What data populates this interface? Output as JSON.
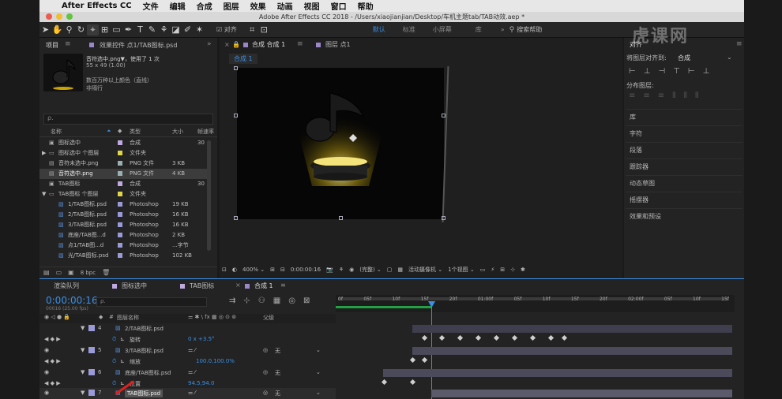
{
  "menubar": {
    "apple": "",
    "app": "After Effects CC",
    "items": [
      "文件",
      "编辑",
      "合成",
      "图层",
      "效果",
      "动画",
      "视图",
      "窗口",
      "帮助"
    ]
  },
  "window": {
    "title": "Adobe After Effects CC 2018 - /Users/xiaojianjian/Desktop/车机主题tab/TAB动效.aep *"
  },
  "toolbar": {
    "align_label": "对齐",
    "workspaces": [
      "默认",
      "标准",
      "小屏幕",
      "库"
    ],
    "search_label": "搜索帮助"
  },
  "project": {
    "tab_label": "项目",
    "effects_tab": "效果控件 点1/TAB图标.psd",
    "preview_name": "音符选中.png▼，使用了 1 次",
    "preview_dims": "55 x 49 (1.00)",
    "preview_colors": "数百万种以上颜色（直线）",
    "preview_interlace": "非隔行",
    "search_placeholder": "ρ.",
    "columns": {
      "name": "名称",
      "type": "类型",
      "size": "大小",
      "fps": "帧速率"
    },
    "rows": [
      {
        "name": "图标选中",
        "type": "合成",
        "size": "",
        "fps": "30"
      },
      {
        "name": "图标选中 个图层",
        "type": "文件夹",
        "size": "",
        "fps": ""
      },
      {
        "name": "音符未选中.png",
        "type": "PNG 文件",
        "size": "3 KB",
        "fps": ""
      },
      {
        "name": "音符选中.png",
        "type": "PNG 文件",
        "size": "4 KB",
        "fps": ""
      },
      {
        "name": "TAB图标",
        "type": "合成",
        "size": "",
        "fps": "30"
      },
      {
        "name": "TAB图标 个图层",
        "type": "文件夹",
        "size": "",
        "fps": ""
      },
      {
        "name": "1/TAB图标.psd",
        "type": "Photoshop",
        "size": "19 KB",
        "fps": ""
      },
      {
        "name": "2/TAB图标.psd",
        "type": "Photoshop",
        "size": "16 KB",
        "fps": ""
      },
      {
        "name": "3/TAB图标.psd",
        "type": "Photoshop",
        "size": "16 KB",
        "fps": ""
      },
      {
        "name": "底座/TAB图...d",
        "type": "Photoshop",
        "size": "2 KB",
        "fps": ""
      },
      {
        "name": "点1/TAB图...d",
        "type": "Photoshop",
        "size": "...字节",
        "fps": ""
      },
      {
        "name": "光/TAB图标.psd",
        "type": "Photoshop",
        "size": "102 KB",
        "fps": ""
      }
    ],
    "bpc": "8 bpc"
  },
  "composition": {
    "tab_label": "合成 合成 1",
    "layer_tab": "图层 点1",
    "breadcrumb": "合成 1",
    "zoom": "400%",
    "timecode": "0:00:00:16",
    "quality": "(完整)",
    "camera": "活动摄像机",
    "views": "1个视图"
  },
  "right_panel": {
    "title": "对齐",
    "align_to_label": "将图层对齐到:",
    "align_to_value": "合成",
    "distribute_label": "分布图层:",
    "items": [
      "库",
      "字符",
      "段落",
      "跟踪器",
      "动态草图",
      "摇摆器",
      "效果和预设"
    ]
  },
  "timeline": {
    "tabs": [
      "渲染队列",
      "图标选中",
      "TAB图标",
      "合成 1"
    ],
    "timecode": "0:00:00:16",
    "fps": "00016 (25.00 fps)",
    "search_placeholder": "ρ.",
    "layer_header": "图层名称",
    "parent_header": "父级",
    "ruler": [
      "0f",
      "05f",
      "10f",
      "15f",
      "20f",
      "01:00f",
      "05f",
      "10f",
      "15f",
      "20f",
      "02:00f",
      "05f",
      "10f",
      "15f"
    ],
    "rows": [
      {
        "num": "4",
        "name": "2/TAB图标.psd",
        "prop": "",
        "value": "",
        "parent": ""
      },
      {
        "num": "",
        "name": "",
        "prop": "旋转",
        "value": "0 x +3.5°",
        "parent": ""
      },
      {
        "num": "5",
        "name": "3/TAB图标.psd",
        "prop": "",
        "value": "",
        "parent": "无"
      },
      {
        "num": "",
        "name": "",
        "prop": "缩放",
        "value": "100.0,100.0%",
        "parent": ""
      },
      {
        "num": "6",
        "name": "底座/TAB图标.psd",
        "prop": "",
        "value": "",
        "parent": "无"
      },
      {
        "num": "",
        "name": "",
        "prop": "位置",
        "value": "94.5,94.0",
        "parent": ""
      },
      {
        "num": "7",
        "name": "TAB图标.psd",
        "prop": "",
        "value": "",
        "parent": "无"
      }
    ]
  },
  "watermark": "虎课网",
  "colors": {
    "accent": "#3a8fe8",
    "playhead": "#3a8fe8",
    "workarea": "#22a043"
  }
}
